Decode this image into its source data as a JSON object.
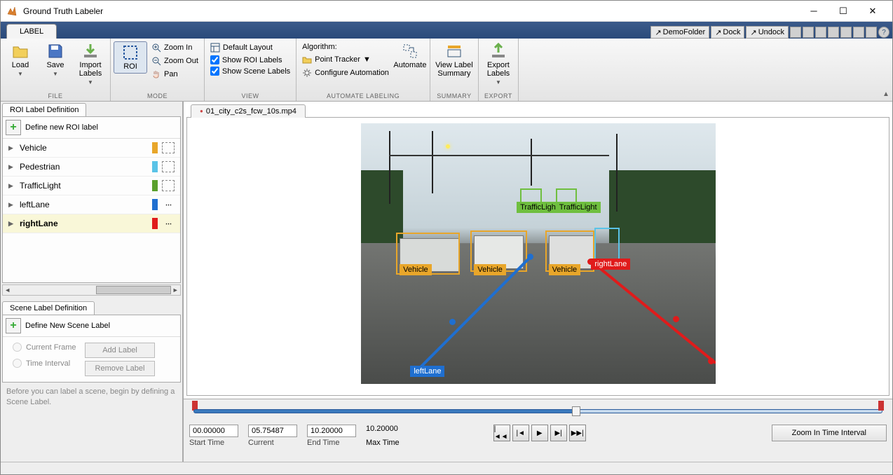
{
  "titlebar": {
    "title": "Ground Truth Labeler"
  },
  "tabrow": {
    "tab": "LABEL",
    "demo": "DemoFolder",
    "dock": "Dock",
    "undock": "Undock"
  },
  "toolstrip": {
    "file": {
      "label": "FILE",
      "load": "Load",
      "save": "Save",
      "import": "Import Labels"
    },
    "mode": {
      "label": "MODE",
      "roi": "ROI",
      "zoomin": "Zoom In",
      "zoomout": "Zoom Out",
      "pan": "Pan"
    },
    "view": {
      "label": "VIEW",
      "default_layout": "Default Layout",
      "show_roi": "Show ROI Labels",
      "show_scene": "Show Scene Labels"
    },
    "automate": {
      "label": "AUTOMATE LABELING",
      "algo_label": "Algorithm:",
      "algo": "Point Tracker",
      "configure": "Configure Automation",
      "automate_btn": "Automate"
    },
    "summary": {
      "label": "SUMMARY",
      "btn": "View Label Summary"
    },
    "export": {
      "label": "EXPORT",
      "btn": "Export Labels"
    }
  },
  "roi_panel": {
    "title": "ROI Label Definition",
    "define": "Define new ROI label",
    "items": [
      {
        "name": "Vehicle",
        "color": "#e8a62a",
        "shape": "rect"
      },
      {
        "name": "Pedestrian",
        "color": "#5ac3e7",
        "shape": "rect"
      },
      {
        "name": "TrafficLight",
        "color": "#5aa02c",
        "shape": "rect"
      },
      {
        "name": "leftLane",
        "color": "#1f6fd0",
        "shape": "line"
      },
      {
        "name": "rightLane",
        "color": "#e01b1b",
        "shape": "line"
      }
    ]
  },
  "scene_panel": {
    "title": "Scene Label Definition",
    "define": "Define New Scene Label",
    "current": "Current Frame",
    "interval": "Time Interval",
    "add": "Add Label",
    "remove": "Remove Label",
    "hint": "Before you can label a scene, begin by defining a Scene Label."
  },
  "video": {
    "tab": "01_city_c2s_fcw_10s.mp4",
    "annotations": {
      "traffic1": "TrafficLight",
      "traffic2": "TrafficLight",
      "veh1": "Vehicle",
      "veh2": "Vehicle",
      "veh3": "Vehicle",
      "rightlane": "rightLane",
      "leftlane": "leftLane"
    }
  },
  "timeline": {
    "start": {
      "val": "00.00000",
      "lbl": "Start Time"
    },
    "current": {
      "val": "05.75487",
      "lbl": "Current"
    },
    "end": {
      "val": "10.20000",
      "lbl": "End Time"
    },
    "max": {
      "val": "10.20000",
      "lbl": "Max Time"
    },
    "zoom": "Zoom In Time Interval"
  }
}
